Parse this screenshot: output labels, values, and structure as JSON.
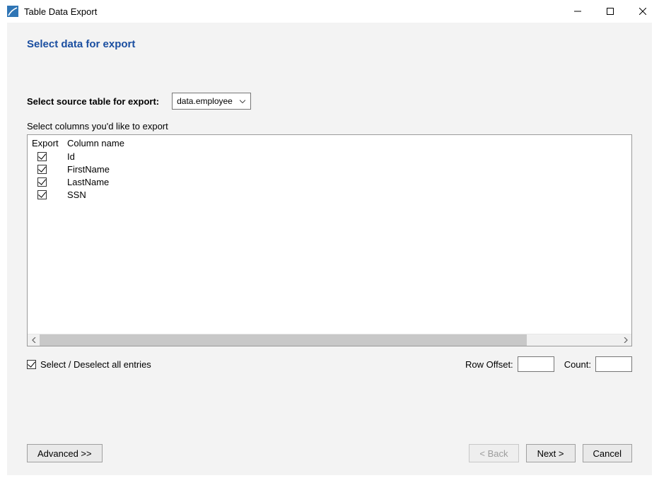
{
  "window": {
    "title": "Table Data Export"
  },
  "heading": "Select data for export",
  "source": {
    "label": "Select source table for export:",
    "selected": "data.employee"
  },
  "columns": {
    "instruction": "Select columns you'd like to export",
    "headers": {
      "export": "Export",
      "name": "Column name"
    },
    "items": [
      {
        "checked": true,
        "name": "Id"
      },
      {
        "checked": true,
        "name": "FirstName"
      },
      {
        "checked": true,
        "name": "LastName"
      },
      {
        "checked": true,
        "name": "SSN"
      }
    ]
  },
  "selectAll": {
    "checked": true,
    "label": "Select / Deselect all entries"
  },
  "rowOffset": {
    "label": "Row Offset:",
    "value": ""
  },
  "count": {
    "label": "Count:",
    "value": ""
  },
  "buttons": {
    "advanced": "Advanced >>",
    "back": "< Back",
    "next": "Next >",
    "cancel": "Cancel"
  }
}
